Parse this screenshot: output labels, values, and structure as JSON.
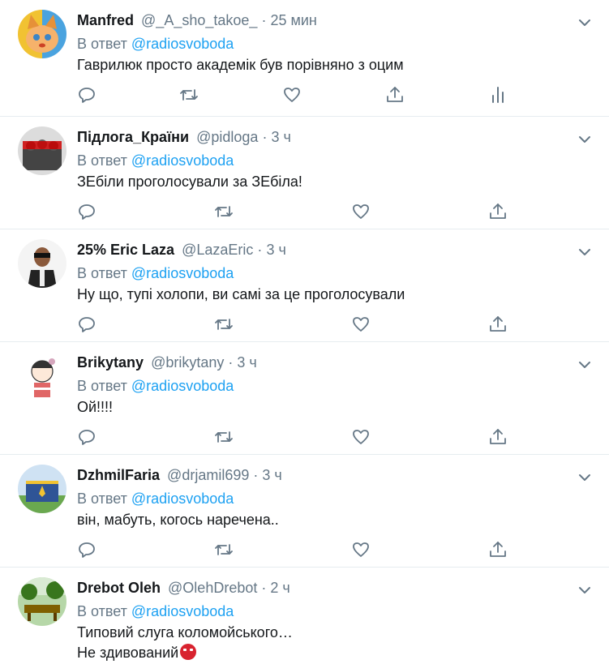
{
  "reply_prefix": "В ответ",
  "colors": {
    "link": "#1da1f2",
    "muted": "#657786",
    "text": "#14171a",
    "divider": "#e6ecf0"
  },
  "tweets": [
    {
      "name": "Manfred",
      "handle": "@_A_sho_takoe_",
      "dot": "·",
      "time": "25 мин",
      "reply_to": "@radiosvoboda",
      "text": "Гаврилюк просто академік був порівняно з оцим"
    },
    {
      "name": "Підлога_Країни",
      "handle": "@pidloga",
      "dot": "·",
      "time": "3 ч",
      "reply_to": "@radiosvoboda",
      "text": "ЗЕбіли проголосували за ЗЕбіла!"
    },
    {
      "name": "25% Eric Laza",
      "handle": "@LazaEric",
      "dot": "·",
      "time": "3 ч",
      "reply_to": "@radiosvoboda",
      "text": "Ну що, тупі холопи, ви самі за це проголосували"
    },
    {
      "name": "Brikytany",
      "handle": "@brikytany",
      "dot": "·",
      "time": "3 ч",
      "reply_to": "@radiosvoboda",
      "text": "Ой!!!!"
    },
    {
      "name": "DzhmilFaria",
      "handle": "@drjamil699",
      "dot": "·",
      "time": "3 ч",
      "reply_to": "@radiosvoboda",
      "text": "він, мабуть, когось наречена.."
    },
    {
      "name": "Drebot Oleh",
      "handle": "@OlehDrebot",
      "dot": "·",
      "time": "2 ч",
      "reply_to": "@radiosvoboda",
      "text": "Типовий слуга коломойського…",
      "text2": "Не здивований"
    }
  ],
  "icons": [
    "reply-icon",
    "retweet-icon",
    "like-icon",
    "share-icon",
    "analytics-icon",
    "caret-down-icon",
    "angry-face-emoji"
  ]
}
